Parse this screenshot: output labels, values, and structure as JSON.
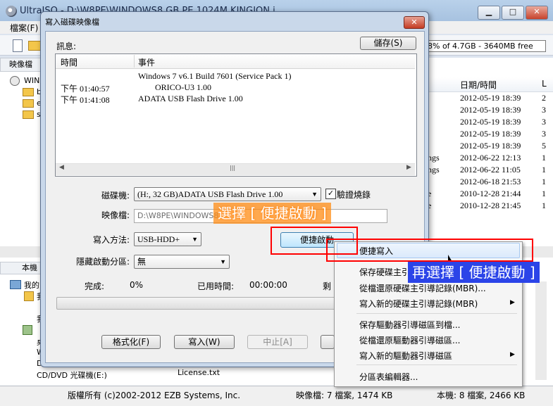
{
  "main": {
    "title": "UltraISO - D:\\W8PE\\WINDOWS8 GB PE 1024M KINGION.i",
    "menu_file": "檔案(F)",
    "size_info": "8% of 4.7GB - 3640MB free",
    "image_pane_label": "映像檔",
    "tree_root": "WINI",
    "tree_items": [
      "b",
      "e",
      "s"
    ],
    "file_header_date": "日期/時間",
    "file_header_l": "L",
    "file_dates": [
      "2012-05-19 18:39",
      "2012-05-19 18:39",
      "2012-05-19 18:39",
      "2012-05-19 18:39",
      "2012-05-19 18:39",
      "2012-06-22 12:13",
      "2012-06-22 11:05",
      "2012-06-18 21:53",
      "2010-12-28 21:44",
      "2010-12-28 21:45"
    ],
    "file_sizes": [
      "2",
      "3",
      "3",
      "3",
      "5",
      "1",
      "1",
      "1",
      "1",
      "1"
    ],
    "file_types": [
      "ngs",
      "ngs",
      "e",
      "e"
    ],
    "local_pane_label": "本機",
    "local_tree": [
      "我的",
      "我",
      "我",
      "桌",
      "W",
      "D"
    ],
    "local_cd": "CD/DVD 光碟機(E:)",
    "local_license": "License.txt",
    "status": {
      "copyright": "版權所有 (c)2002-2012 EZB Systems, Inc.",
      "image_info": "映像檔: 7 檔案, 1474 KB",
      "local_info": "本機: 8 檔案, 2466 KB"
    }
  },
  "dialog": {
    "title": "寫入磁碟映像檔",
    "info_label": "訊息:",
    "save_button": "儲存(S)",
    "log_headers": {
      "time": "時間",
      "event": "事件"
    },
    "log_rows": [
      {
        "time": "",
        "event": "Windows 7 v6.1 Build 7601 (Service Pack 1)"
      },
      {
        "time": "下午 01:40:57",
        "event": "ORICO-U3        1.00"
      },
      {
        "time": "下午 01:41:08",
        "event": "ADATA   USB Flash Drive 1.00"
      }
    ],
    "drive_label": "磁碟機:",
    "drive_value": "(H:, 32 GB)ADATA   USB Flash Drive 1.00",
    "verify_label": "驗證燒錄",
    "verify_checked": "✓",
    "image_label": "映像檔:",
    "image_value": "D:\\W8PE\\WINDOWS8",
    "method_label": "寫入方法:",
    "method_value": "USB-HDD+",
    "boot_button": "便捷啟動",
    "hidden_label": "隱藏啟動分區:",
    "hidden_value": "無",
    "done_label": "完成:",
    "done_value": "0%",
    "elapsed_label": "已用時間:",
    "elapsed_value": "00:00:00",
    "remaining_label": "剩",
    "progress": 0,
    "format_button": "格式化(F)",
    "write_button": "寫入(W)",
    "abort_button": "中止[A]"
  },
  "context_menu": {
    "items": [
      {
        "label": "便捷寫入",
        "submenu": false
      },
      {
        "label": "保存硬碟主引",
        "submenu": false
      },
      {
        "label": "從檔還原硬碟主引導記錄(MBR)...",
        "submenu": false
      },
      {
        "label": "寫入新的硬碟主引導記錄(MBR)",
        "submenu": true
      },
      {
        "label": "保存驅動器引導磁區到檔...",
        "submenu": false
      },
      {
        "label": "從檔還原驅動器引導磁區...",
        "submenu": false
      },
      {
        "label": "寫入新的驅動器引導磁區",
        "submenu": true
      },
      {
        "label": "分區表編輯器...",
        "submenu": false
      }
    ],
    "submenu_arrow": "▶"
  },
  "annotations": {
    "step1": "選擇 [ 便捷啟動 ]",
    "step2": "再選擇 [ 便捷啟動 ]"
  },
  "colors": {
    "annotation_red": "#ff0000",
    "note1_bg": "#ff8c14",
    "note2_bg": "#2b44e8"
  }
}
